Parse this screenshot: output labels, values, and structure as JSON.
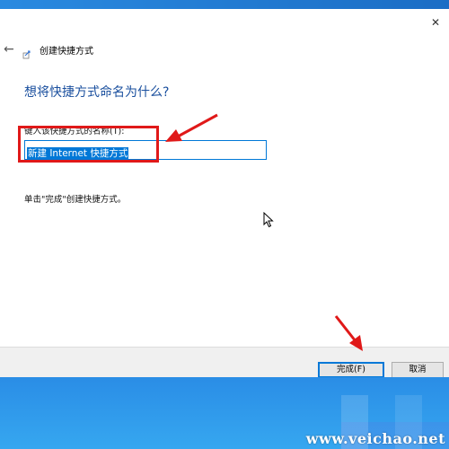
{
  "window": {
    "close_glyph": "✕"
  },
  "wizard": {
    "title": "创建快捷方式",
    "back_glyph": "←",
    "heading": "想将快捷方式命名为什么?",
    "field_label": "键入该快捷方式的名称(T):",
    "field_value": "新建 Internet 快捷方式",
    "hint": "单击\"完成\"创建快捷方式。"
  },
  "footer": {
    "finish_label": "完成(F)",
    "cancel_label": "取消"
  },
  "watermark": "www.veichao.net",
  "colors": {
    "accent": "#0078d7",
    "heading": "#1a4f9e",
    "annotation": "#e01919"
  }
}
